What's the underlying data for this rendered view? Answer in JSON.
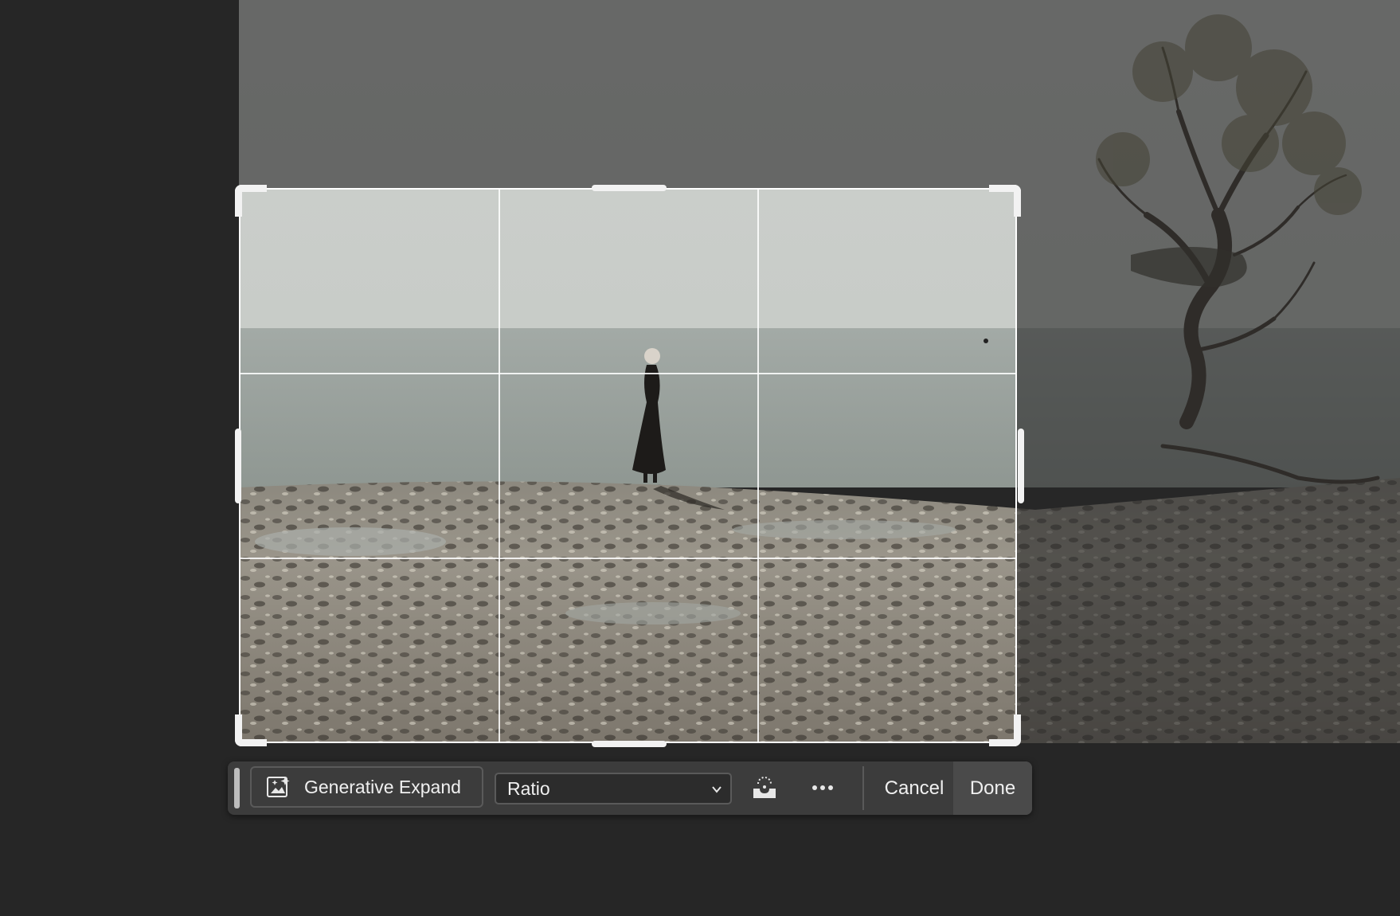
{
  "canvas": {
    "photo_description_icon": "lakeside-photo",
    "colors": {
      "sky": "#cfd2cf",
      "water": "#9aa19d",
      "pebbles": "#8f8a80",
      "background": "#262626"
    }
  },
  "toolbar": {
    "generative_expand_label": "Generative Expand",
    "ratio_value": "Ratio",
    "cancel_label": "Cancel",
    "done_label": "Done",
    "icons": {
      "generative_expand": "generative-expand-icon",
      "straighten": "straighten-icon",
      "more": "more-options-icon",
      "dropdown": "chevron-down-icon"
    }
  }
}
